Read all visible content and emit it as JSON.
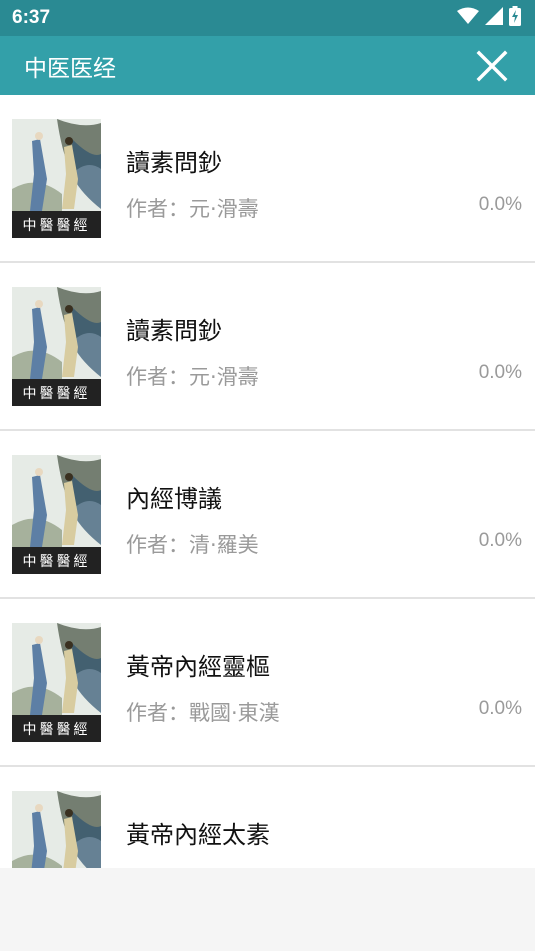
{
  "status_bar": {
    "time": "6:37",
    "icons": [
      "wifi-icon",
      "signal-icon",
      "battery-charging-icon"
    ]
  },
  "app_bar": {
    "title": "中医医经",
    "close_icon": "close-icon"
  },
  "colors": {
    "status_bar": "#2a8a93",
    "app_bar": "#33a0a9",
    "title_text": "#111111",
    "secondary_text": "#9a9a9a",
    "divider": "#e2e2e2"
  },
  "books": [
    {
      "title": "讀素問鈔",
      "author": "作者：元·滑壽",
      "progress": "0.0%",
      "cover_label": "中醫醫經"
    },
    {
      "title": "讀素問鈔",
      "author": "作者：元·滑壽",
      "progress": "0.0%",
      "cover_label": "中醫醫經"
    },
    {
      "title": "內經博議",
      "author": "作者：清·羅美",
      "progress": "0.0%",
      "cover_label": "中醫醫經"
    },
    {
      "title": "黃帝內經靈樞",
      "author": "作者：戰國·東漢",
      "progress": "0.0%",
      "cover_label": "中醫醫經"
    },
    {
      "title": "黃帝內經太素",
      "author": "",
      "progress": "",
      "cover_label": ""
    }
  ]
}
